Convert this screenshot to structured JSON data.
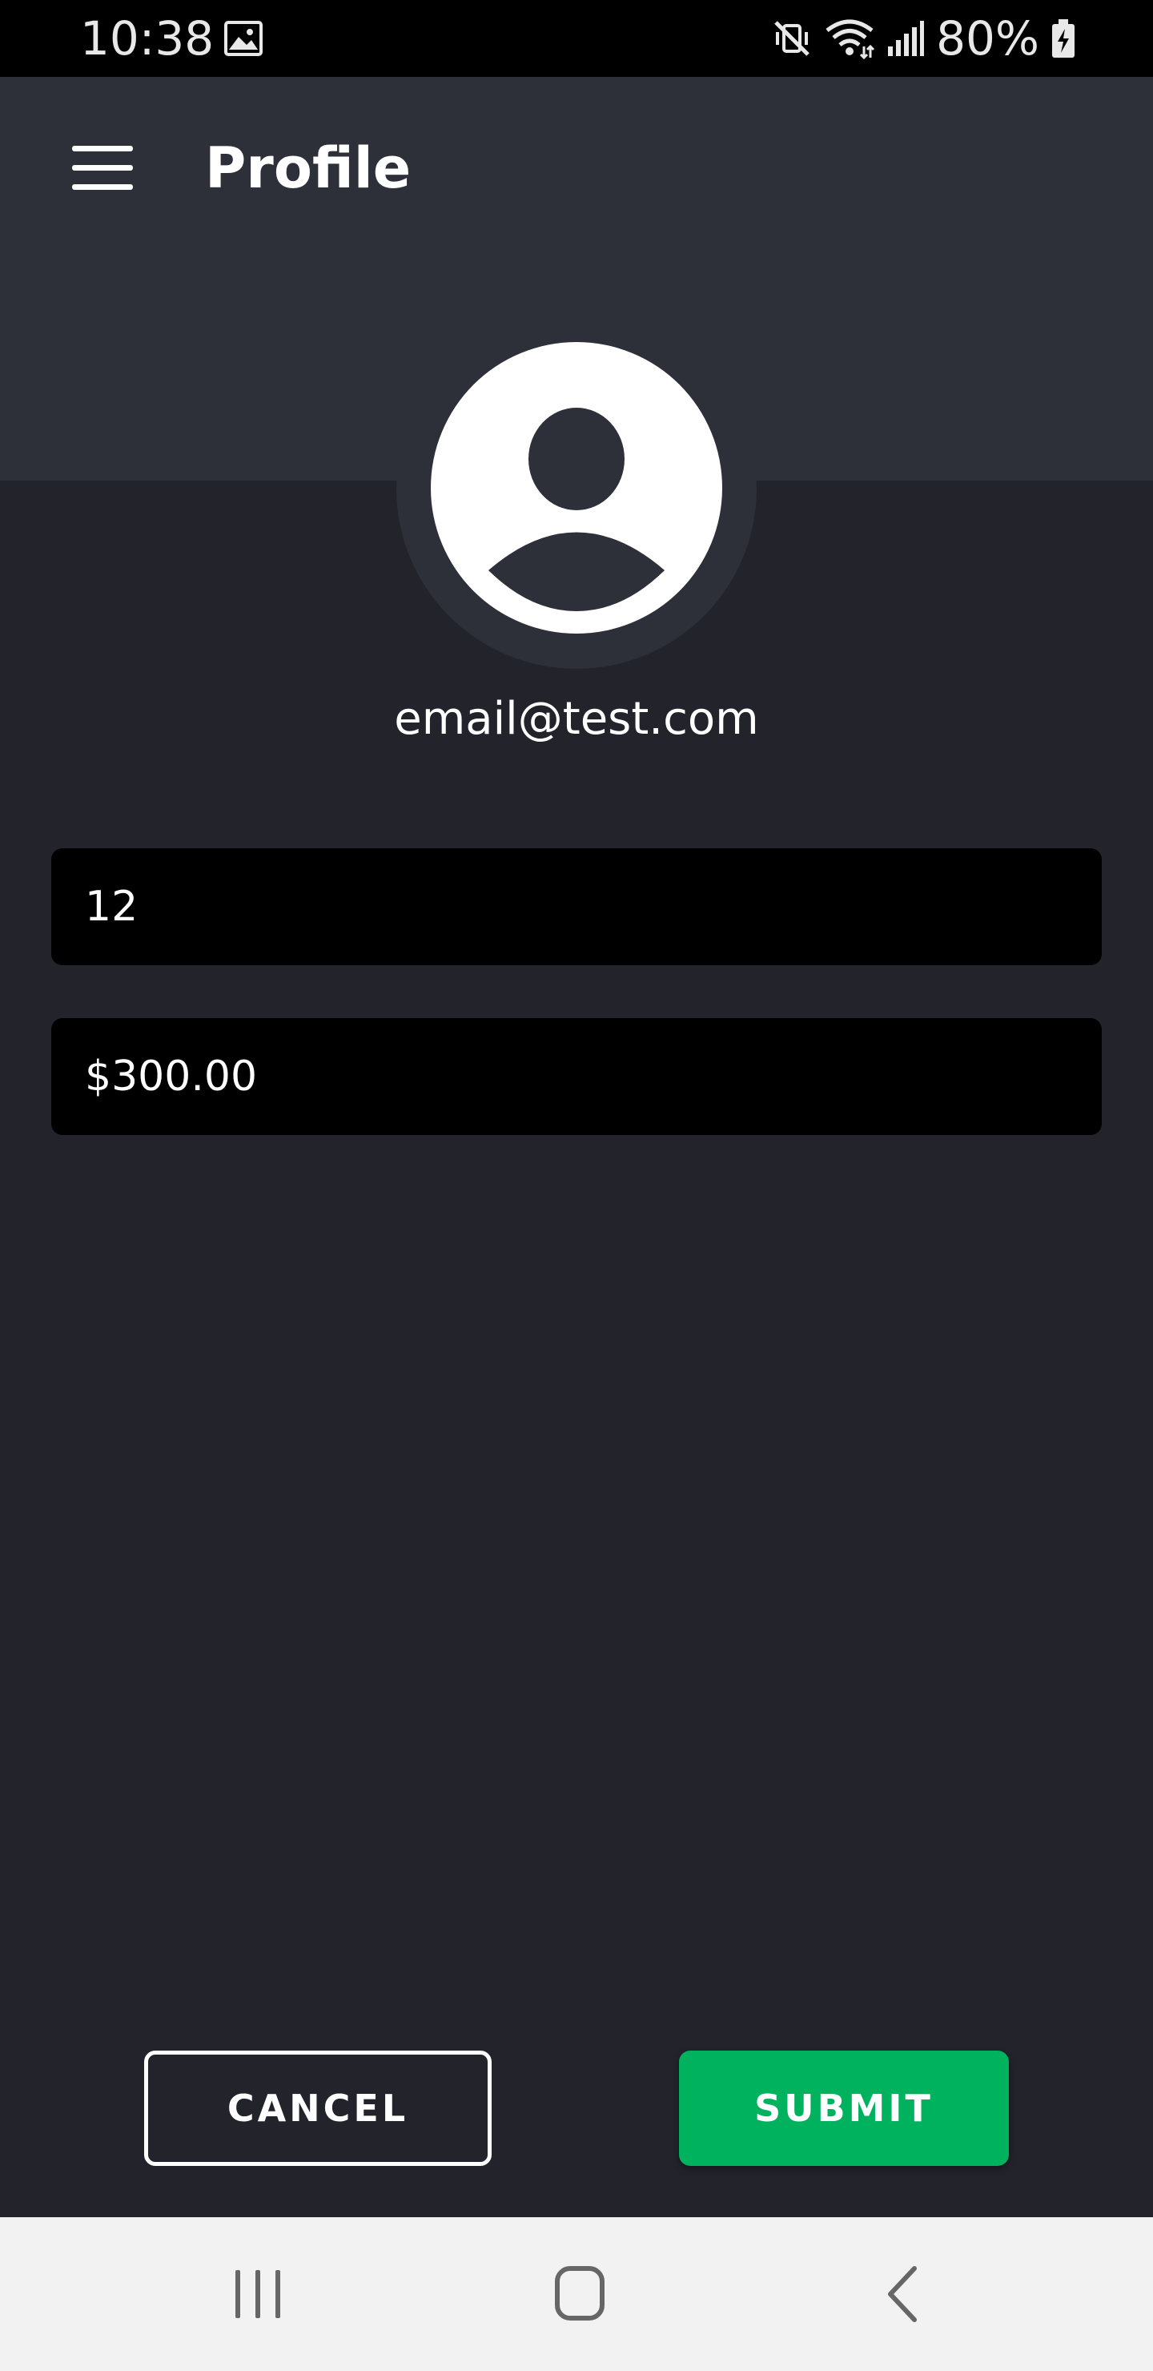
{
  "status_bar": {
    "time": "10:38",
    "battery": "80%",
    "icons": [
      "gallery-icon",
      "mute-vibrate-icon",
      "wifi-icon",
      "signal-icon",
      "battery-charging-icon"
    ]
  },
  "header": {
    "title": "Profile",
    "menu_icon": "menu-icon"
  },
  "profile": {
    "avatar_icon": "person-icon",
    "email": "email@test.com"
  },
  "form": {
    "count_value": "12",
    "amount_value": "$300.00"
  },
  "actions": {
    "cancel_label": "CANCEL",
    "submit_label": "SUBMIT"
  },
  "nav_bar": {
    "icons": [
      "recents-icon",
      "home-icon",
      "back-icon"
    ]
  },
  "colors": {
    "background": "#22232b",
    "header": "#2e3039",
    "input": "#000000",
    "submit": "#00b25e",
    "nav_bar": "#f2f2f2"
  }
}
